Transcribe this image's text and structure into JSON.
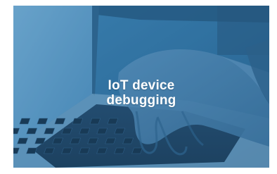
{
  "hero": {
    "title_line1": "IoT device",
    "title_line2": "debugging",
    "overlay_color": "#2f6f9e",
    "image": "laptop-typing-photo"
  }
}
